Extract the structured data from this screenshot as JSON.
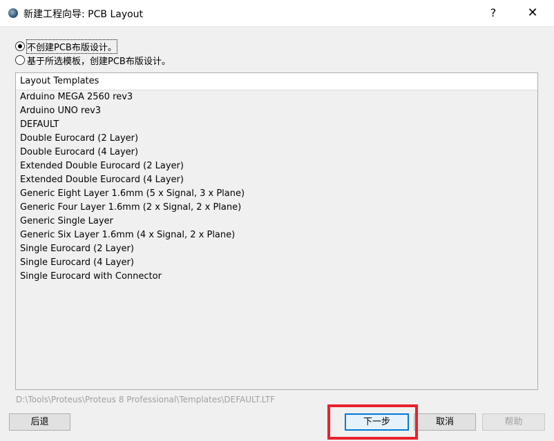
{
  "window": {
    "title": "新建工程向导: PCB Layout",
    "help_glyph": "?",
    "close_glyph": "✕"
  },
  "options": {
    "no_pcb": "不创建PCB布版设计。",
    "from_template": "基于所选模板，创建PCB布版设计。",
    "selected": "no_pcb"
  },
  "templates": {
    "header": "Layout Templates",
    "items": [
      "Arduino MEGA 2560 rev3",
      "Arduino UNO rev3",
      "DEFAULT",
      "Double Eurocard (2 Layer)",
      "Double Eurocard (4 Layer)",
      "Extended Double Eurocard (2 Layer)",
      "Extended Double Eurocard (4 Layer)",
      "Generic Eight Layer 1.6mm (5 x Signal, 3 x Plane)",
      "Generic Four Layer 1.6mm (2 x Signal, 2 x Plane)",
      "Generic Single Layer",
      "Generic Six Layer 1.6mm (4 x Signal, 2 x Plane)",
      "Single Eurocard (2 Layer)",
      "Single Eurocard (4 Layer)",
      "Single Eurocard with Connector"
    ]
  },
  "template_path": "D:\\Tools\\Proteus\\Proteus 8 Professional\\Templates\\DEFAULT.LTF",
  "buttons": {
    "back": "后退",
    "next": "下一步",
    "cancel": "取消",
    "help": "帮助"
  },
  "colors": {
    "highlight": "#e8212b",
    "default_button_border": "#0078d7"
  }
}
